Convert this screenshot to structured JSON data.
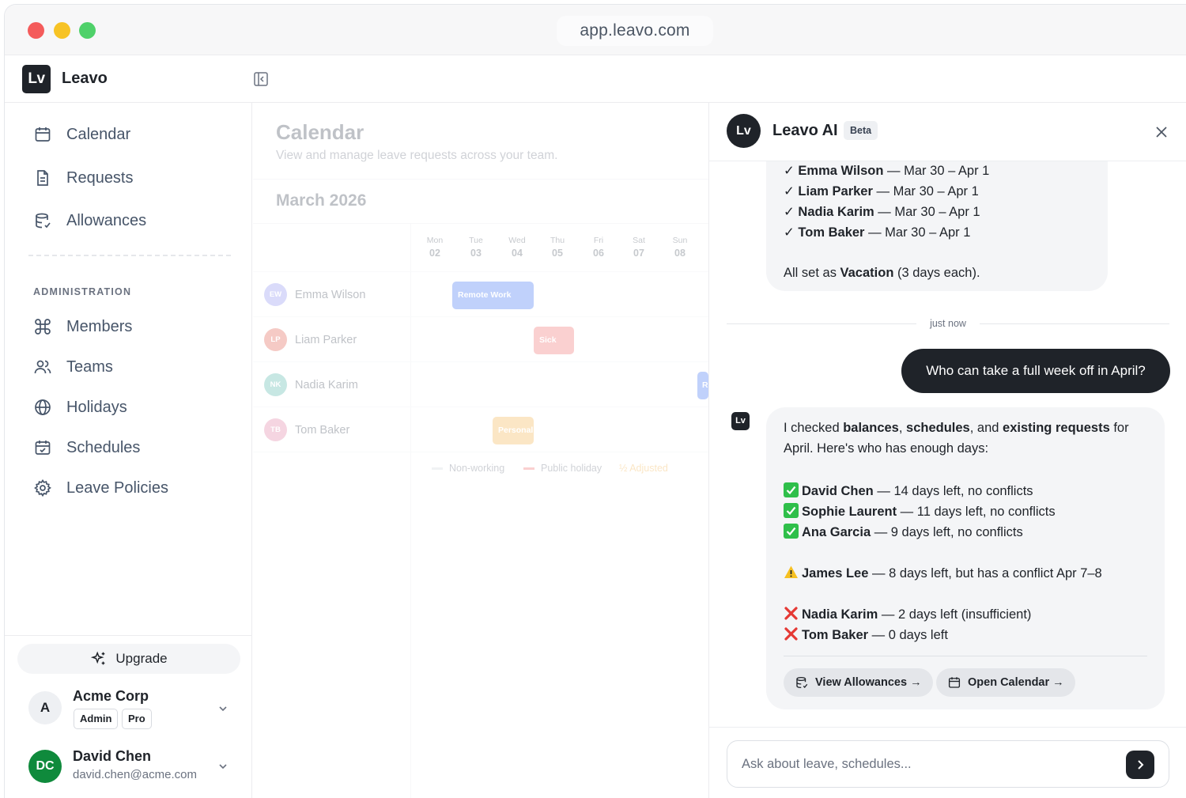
{
  "browser": {
    "url": "app.leavo.com"
  },
  "app": {
    "logo_text": "Lv",
    "name": "Leavo"
  },
  "sidebar": {
    "items": [
      {
        "label": "Calendar",
        "icon": "calendar-icon"
      },
      {
        "label": "Requests",
        "icon": "document-icon"
      },
      {
        "label": "Allowances",
        "icon": "database-icon"
      }
    ],
    "admin_label": "ADMINISTRATION",
    "admin_items": [
      {
        "label": "Members",
        "icon": "command-icon"
      },
      {
        "label": "Teams",
        "icon": "users-icon"
      },
      {
        "label": "Holidays",
        "icon": "globe-icon"
      },
      {
        "label": "Schedules",
        "icon": "calendar-check-icon"
      },
      {
        "label": "Leave Policies",
        "icon": "gear-icon"
      }
    ],
    "upgrade_label": "Upgrade",
    "org": {
      "initial": "A",
      "name": "Acme Corp",
      "role_badge": "Admin",
      "plan_badge": "Pro"
    },
    "user": {
      "initials": "DC",
      "name": "David Chen",
      "email": "david.chen@acme.com"
    }
  },
  "calendar": {
    "title": "Calendar",
    "subtitle": "View and manage leave requests across your team.",
    "month": "March 2026",
    "days": [
      {
        "name": "Mon",
        "num": "02"
      },
      {
        "name": "Tue",
        "num": "03"
      },
      {
        "name": "Wed",
        "num": "04"
      },
      {
        "name": "Thu",
        "num": "05"
      },
      {
        "name": "Fri",
        "num": "06"
      },
      {
        "name": "Sat",
        "num": "07"
      },
      {
        "name": "Sun",
        "num": "08"
      }
    ],
    "people": [
      {
        "initials": "EW",
        "name": "Emma Wilson",
        "color": "#8b8ff0"
      },
      {
        "initials": "LP",
        "name": "Liam Parker",
        "color": "#e05a4a"
      },
      {
        "initials": "NK",
        "name": "Nadia Karim",
        "color": "#4fb3a8"
      },
      {
        "initials": "TB",
        "name": "Tom Baker",
        "color": "#e07aa0"
      }
    ],
    "leaves": [
      {
        "label": "Remote Work",
        "color": "#3b6ff2"
      },
      {
        "label": "Sick",
        "color": "#ef6b6b"
      },
      {
        "label": "R",
        "color": "#3b6ff2"
      },
      {
        "label": "Personal",
        "color": "#f2b14a"
      }
    ],
    "legend": [
      {
        "label": "Non-working",
        "color": "#d1d5db"
      },
      {
        "label": "Public holiday",
        "color": "#ef6b6b"
      },
      {
        "label": "½ Adjusted",
        "color": "#f2b14a"
      }
    ]
  },
  "ai": {
    "logo_text": "Lv",
    "title": "Leavo AI",
    "badge": "Beta",
    "prev_message": {
      "lines": [
        {
          "name": "Emma Wilson",
          "rest": " — Mar 30 – Apr 1"
        },
        {
          "name": "Liam Parker",
          "rest": " — Mar 30 – Apr 1"
        },
        {
          "name": "Nadia Karim",
          "rest": " — Mar 30 – Apr 1"
        },
        {
          "name": "Tom Baker",
          "rest": " — Mar 30 – Apr 1"
        }
      ],
      "summary_pre": "All set as ",
      "summary_bold": "Vacation",
      "summary_post": " (3 days each)."
    },
    "timestamp": "just now",
    "user_message": "Who can take a full week off in April?",
    "reply": {
      "intro_1": "I checked ",
      "b1": "balances",
      "s1": ", ",
      "b2": "schedules",
      "s2": ", and ",
      "b3": "existing requests",
      "s3": " for",
      "intro_2": "April. Here's who has enough days:",
      "ok": [
        {
          "name": "David Chen",
          "rest": " — 14 days left, no conflicts"
        },
        {
          "name": "Sophie Laurent",
          "rest": " — 11 days left, no conflicts"
        },
        {
          "name": "Ana Garcia",
          "rest": " — 9 days left, no conflicts"
        }
      ],
      "warn": {
        "name": "James Lee",
        "rest": " — 8 days left, but has a conflict Apr 7–8"
      },
      "bad": [
        {
          "name": "Nadia Karim",
          "rest": " — 2 days left (insufficient)"
        },
        {
          "name": "Tom Baker",
          "rest": " — 0 days left"
        }
      ],
      "btn_allowances": "View Allowances →",
      "btn_calendar": "Open Calendar →"
    },
    "input_placeholder": "Ask about leave, schedules..."
  }
}
